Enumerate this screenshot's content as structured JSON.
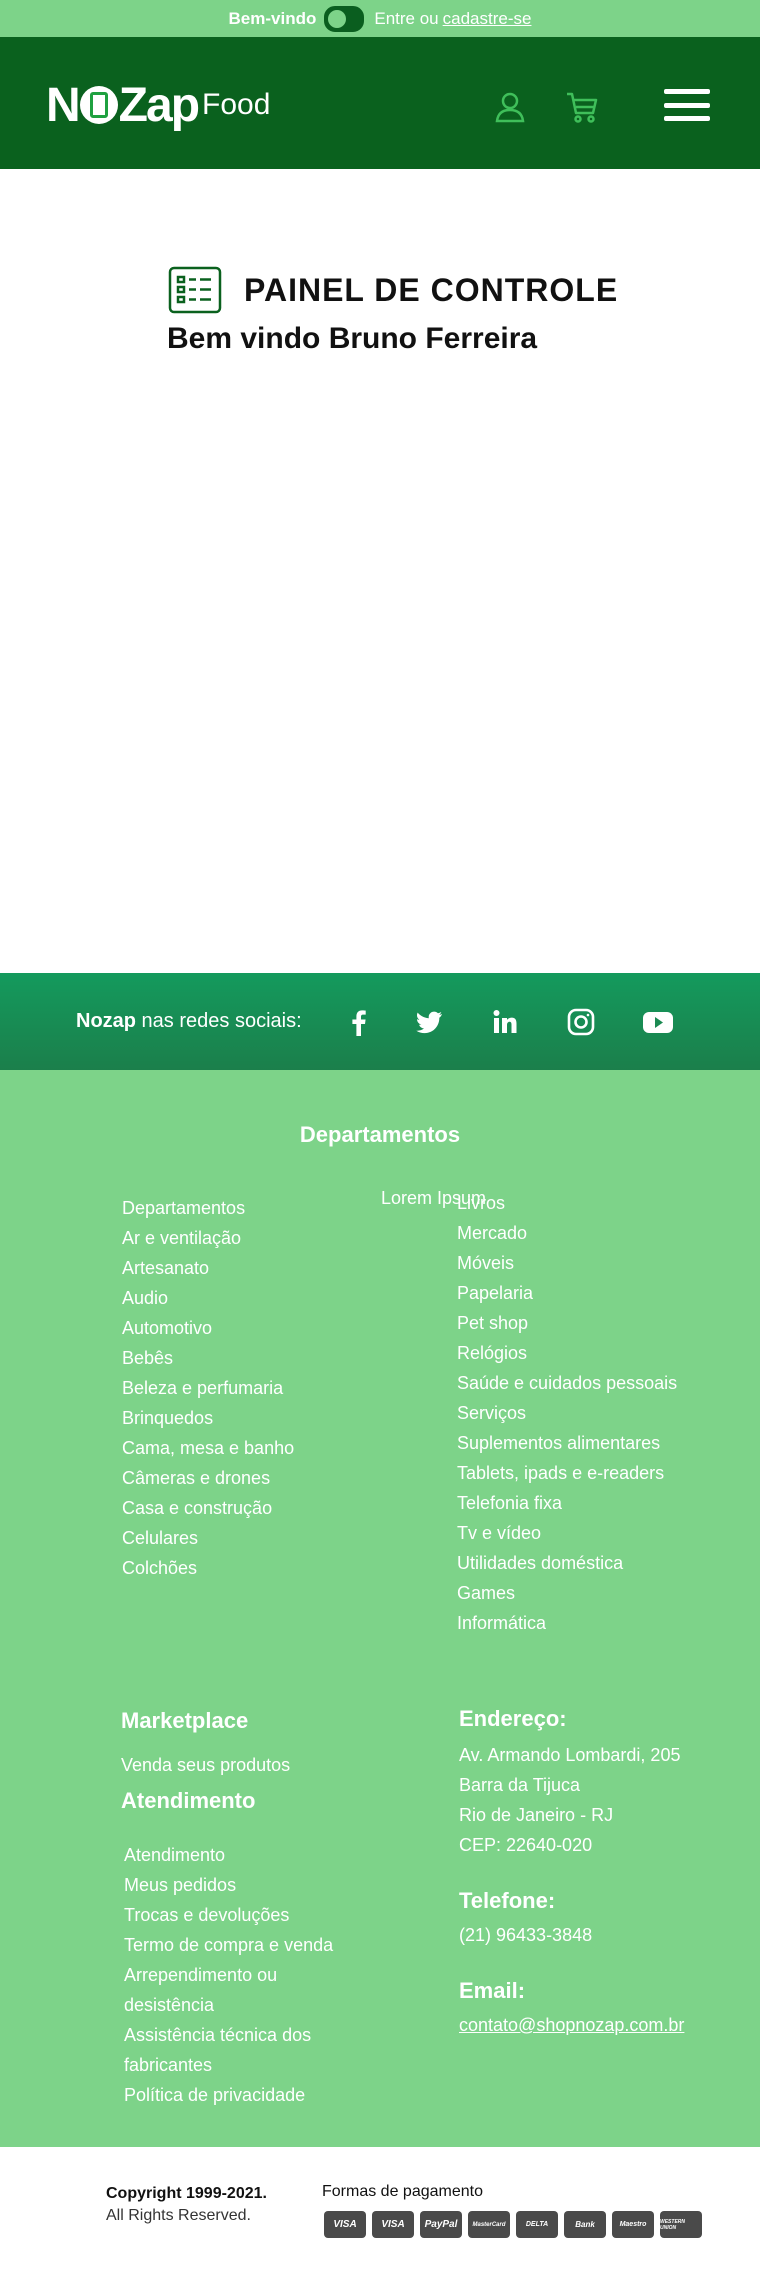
{
  "topbar": {
    "welcome": "Bem-vindo",
    "login_prefix": "Entre ou",
    "signup_link": "cadastre-se"
  },
  "header": {
    "logo_text_left": "N",
    "logo_text_mid": "Zap",
    "logo_text_right": "Food",
    "icons": [
      "user-icon",
      "cart-icon",
      "menu-icon"
    ]
  },
  "dashboard": {
    "title": "PAINEL DE CONTROLE",
    "welcome": "Bem vindo Bruno Ferreira"
  },
  "social": {
    "brand": "Nozap",
    "label": " nas redes sociais:",
    "icons": [
      "facebook-icon",
      "twitter-icon",
      "linkedin-icon",
      "instagram-icon",
      "youtube-icon"
    ]
  },
  "departments": {
    "title": "Departamentos",
    "overlap_text": "Lorem Ipsum",
    "left": [
      "Departamentos",
      "Ar e ventilação",
      "Artesanato",
      "Audio",
      "Automotivo",
      "Bebês",
      "Beleza e perfumaria",
      "Brinquedos",
      "Cama, mesa e banho",
      "Câmeras e drones",
      "Casa e construção",
      "Celulares",
      "Colchões"
    ],
    "right": [
      "Livros",
      "Mercado",
      "Móveis",
      "Papelaria",
      "Pet shop",
      "Relógios",
      "Saúde e cuidados pessoais",
      "Serviços",
      "Suplementos alimentares",
      "Tablets, ipads e e-readers",
      "Telefonia fixa",
      "Tv e vídeo",
      "Utilidades doméstica",
      "Games",
      "Informática"
    ]
  },
  "marketplace": {
    "title": "Marketplace",
    "link": "Venda seus produtos"
  },
  "support": {
    "title": "Atendimento",
    "items": [
      "Atendimento",
      "Meus pedidos",
      "Trocas e devoluções",
      "Termo de compra e venda",
      "Arrependimento ou",
      "desistência",
      "Assistência técnica dos",
      "fabricantes",
      "Política de privacidade"
    ]
  },
  "address": {
    "title": "Endereço:",
    "lines": [
      "Av. Armando Lombardi, 205",
      "Barra da Tijuca",
      "Rio de Janeiro - RJ",
      "CEP: 22640-020"
    ]
  },
  "phone": {
    "title": "Telefone:",
    "value": "(21) 96433-3848"
  },
  "email": {
    "title": "Email:",
    "value": "contato@shopnozap.com.br"
  },
  "bottom": {
    "copyright": "Copyright 1999-2021.",
    "rights": "All Rights Reserved.",
    "payment_label": "Formas de pagamento",
    "payments": [
      "VISA",
      "VISA",
      "PayPal",
      "MasterCard",
      "DELTA",
      "Bank",
      "Maestro",
      "WESTERN UNION"
    ]
  },
  "colors": {
    "topbar": "#7dd389",
    "header": "#0a611e",
    "footer": "#7dd389",
    "social": "#149a5d",
    "icon_green": "#3fbf5a"
  }
}
